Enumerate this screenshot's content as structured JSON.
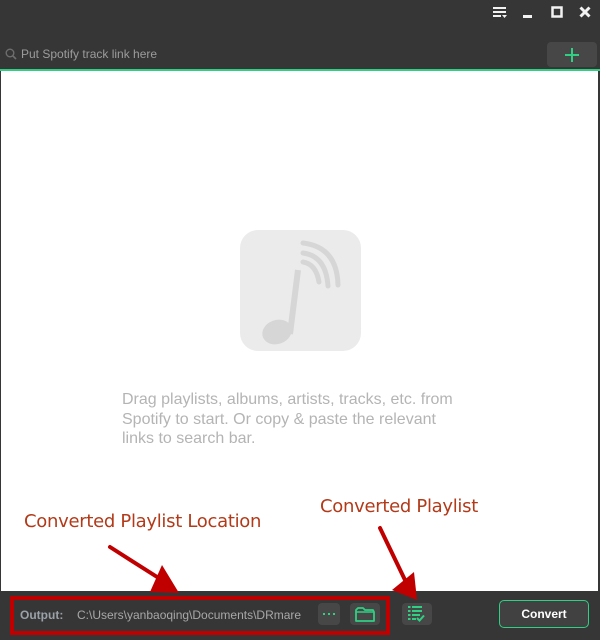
{
  "titlebar": {
    "icons": [
      "menu-icon",
      "minimize-icon",
      "maximize-icon",
      "close-icon"
    ]
  },
  "search": {
    "placeholder": "Put Spotify track link here",
    "value": "",
    "add_icon": "plus-icon"
  },
  "content": {
    "icon": "music-note-icon",
    "hint_lines": [
      "Drag playlists, albums, artists, tracks, etc. from",
      "Spotify to start. Or copy & paste the relevant",
      "links to search bar."
    ]
  },
  "annotations": {
    "location_label": "Converted Playlist Location",
    "playlist_label": "Converted Playlist"
  },
  "footer": {
    "output_label": "Output:",
    "output_path": "C:\\Users\\yanbaoqing\\Documents\\DRmare",
    "more_icon": "ellipsis-icon",
    "folder_icon": "folder-icon",
    "converted_icon": "converted-list-icon",
    "convert_label": "Convert"
  },
  "colors": {
    "accent": "#2fd083",
    "background": "#363636",
    "annotation_red": "#c00000",
    "annotation_text": "#b23a19"
  }
}
